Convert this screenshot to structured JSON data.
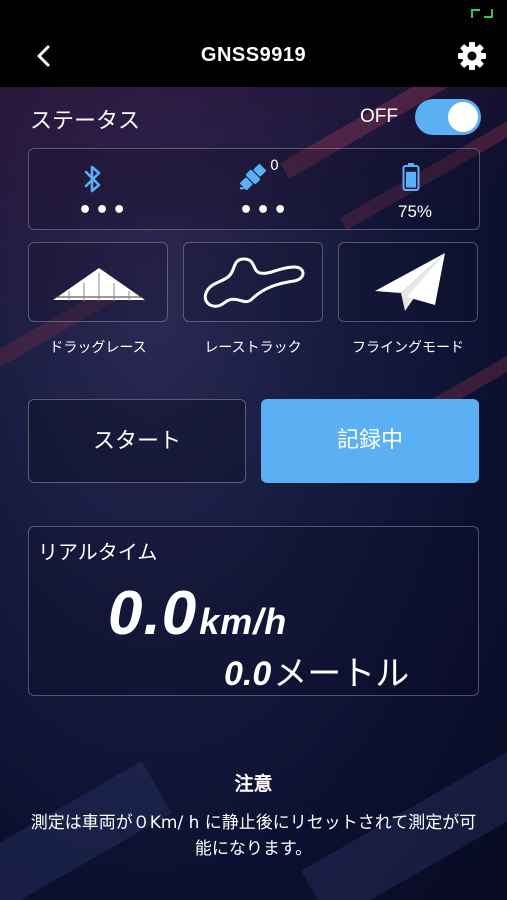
{
  "header": {
    "title": "GNSS9919",
    "back_icon": "chevron-left-icon",
    "settings_icon": "gear-icon"
  },
  "status": {
    "label": "ステータス",
    "toggle_label": "OFF",
    "toggle_on": true,
    "bluetooth": {
      "icon": "bluetooth-icon",
      "value": "•••"
    },
    "satellite": {
      "icon": "satellite-icon",
      "count": "0",
      "value": "•••"
    },
    "battery": {
      "icon": "battery-icon",
      "value": "75%",
      "level": 0.75
    }
  },
  "modes": [
    {
      "icon": "drag-race-icon",
      "label": "ドラッグレース"
    },
    {
      "icon": "race-track-icon",
      "label": "レーストラック"
    },
    {
      "icon": "paper-plane-icon",
      "label": "フライングモード"
    }
  ],
  "actions": {
    "start_label": "スタート",
    "record_label": "記録中"
  },
  "realtime": {
    "label": "リアルタイム",
    "speed_value": "0.0",
    "speed_unit": "km/h",
    "distance_value": "0.0",
    "distance_unit": "メートル"
  },
  "notice": {
    "title": "注意",
    "text": "測定は車両が０Km/ h に静止後にリセットされて測定が可能になります。"
  },
  "colors": {
    "accent": "#5ab0f2",
    "status_indicator": "#35c759",
    "header_bg": "#000000"
  }
}
